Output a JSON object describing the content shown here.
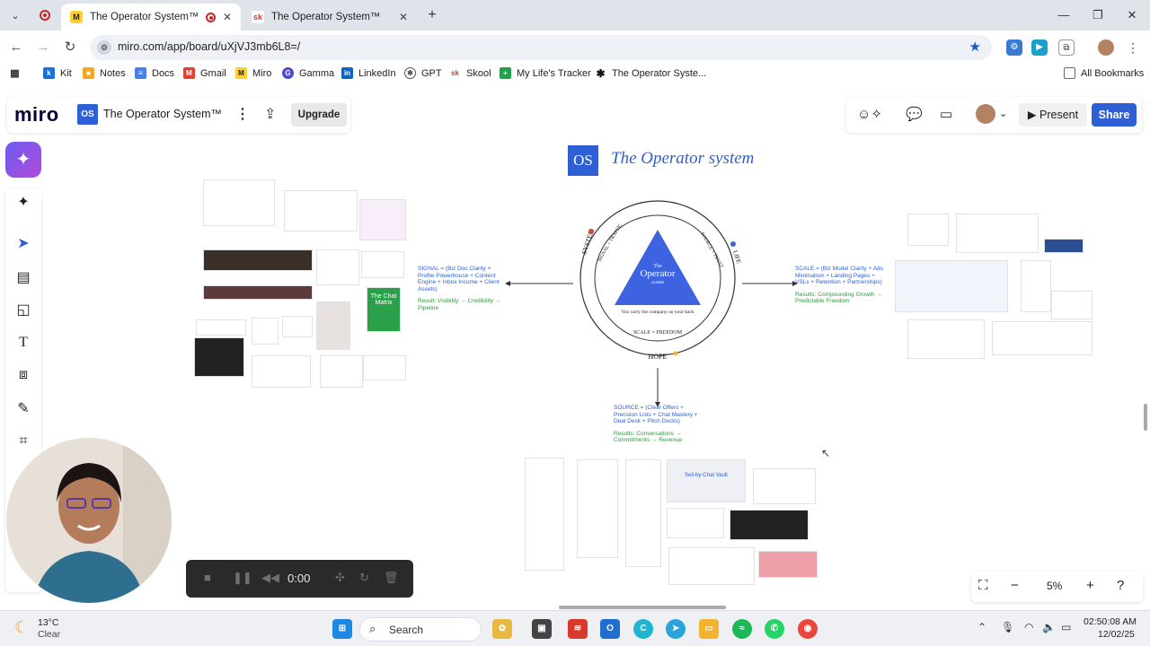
{
  "browser": {
    "tabs": [
      {
        "title": "The Operator System™ - Mi",
        "active": true
      },
      {
        "title": "The Operator System™",
        "active": false
      }
    ],
    "url": "miro.com/app/board/uXjVJ3mb6L8=/",
    "bookmarks": [
      "Kit",
      "Notes",
      "Docs",
      "Gmail",
      "Miro",
      "Gamma",
      "LinkedIn",
      "GPT",
      "Skool",
      "My Life's Tracker",
      "The Operator Syste...",
      "All Bookmarks"
    ]
  },
  "miro": {
    "logo": "miro",
    "board_icon": "OS",
    "board_title": "The Operator System™",
    "upgrade": "Upgrade",
    "present": "Present",
    "share": "Share",
    "zoom_level": "5%",
    "timer": "0:00"
  },
  "canvas": {
    "os_logo": "OS",
    "os_title": "The Operator system",
    "diagram": {
      "system": "SYSTEM",
      "life": "LIFE",
      "hope": "HOPE",
      "signal_traffic": "SIGNAL = TRAFFIC",
      "source_trust": "SOURCE = TRUST",
      "scale_freedom": "SCALE = FREEDOM",
      "operator_the": "The",
      "operator": "Operator",
      "operator_system": "system",
      "carry": "You carry the company on your back"
    },
    "signal": {
      "title": "SIGNAL = (Biz Doc Clarity + Profile Powerhouse + Content Engine + Inbox Income + Client Assets)",
      "result": "Result: Visibility → Credibility → Pipeline"
    },
    "scale": {
      "title": "SCALE = (Biz Model Clarity + Ads Minimalism + Landing Pages + VSLs + Retention + Partnerships)",
      "result": "Results: Compounding Growth → Predictable Freedom"
    },
    "source": {
      "title": "SOURCE = (Clear Offers + Precision Lists + Chat Mastery + Deal Desk + Pitch Decks)",
      "result": "Results: Conversations → Commitments → Revenue"
    },
    "chat_matrix": "The Chat Matrix",
    "vault": "Sell-by-Chat Vault"
  },
  "taskbar": {
    "temp": "13°C",
    "condition": "Clear",
    "search": "Search",
    "time": "02:50:08 AM",
    "date": "12/02/25"
  },
  "colors": {
    "miro_blue": "#2f5fd4",
    "result_green": "#2e9a3f",
    "ai_purple": "#8a55e6"
  }
}
